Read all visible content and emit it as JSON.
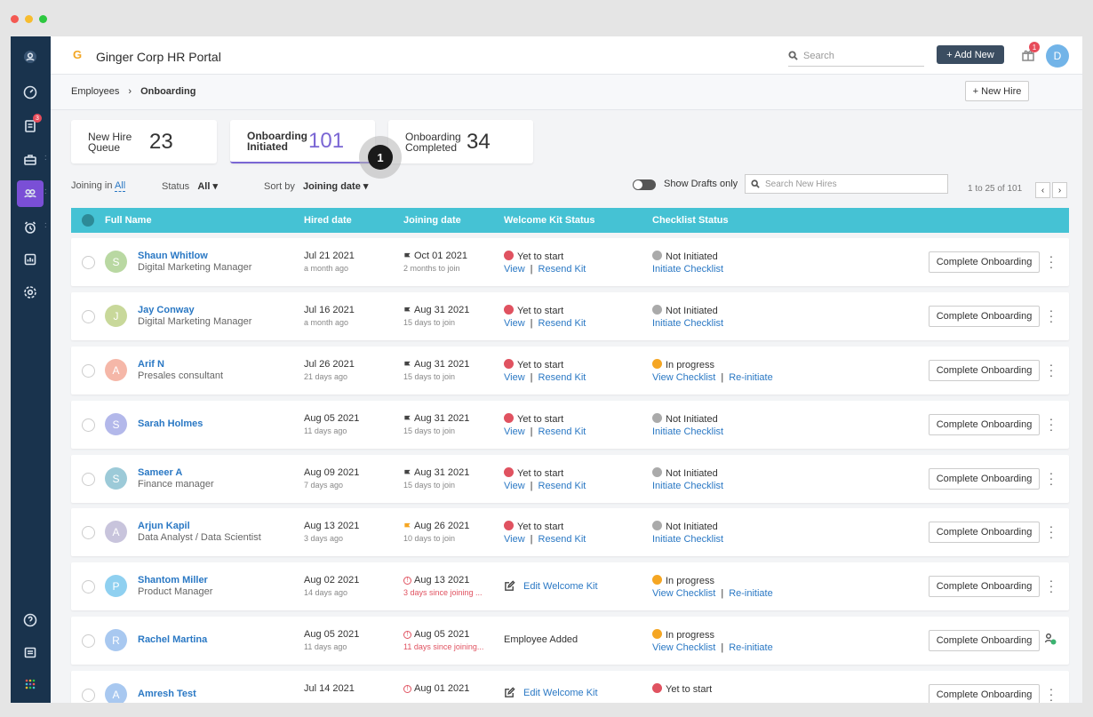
{
  "colors": {
    "accent": "#7a66d4",
    "teal": "#45c2d4",
    "sidebar": "#19334d",
    "red": "#e05260",
    "yellow": "#f5a623",
    "grey": "#aaa"
  },
  "header": {
    "logo": "G",
    "title": "Ginger Corp HR Portal",
    "search_placeholder": "Search",
    "add_new": "+ Add New",
    "gift_badge": "1",
    "user_initial": "D"
  },
  "sidebar": {
    "badge": "3",
    "icons": [
      "dashboard-icon",
      "tasks-icon",
      "briefcase-icon",
      "people-icon",
      "alarm-icon",
      "reports-icon",
      "settings-icon",
      "help-icon",
      "chat-icon",
      "apps-icon"
    ]
  },
  "breadcrumb": {
    "root": "Employees",
    "sep": "›",
    "current": "Onboarding"
  },
  "new_hire_btn": "+ New Hire",
  "cards": [
    {
      "label": "New Hire Queue",
      "count": "23"
    },
    {
      "label": "Onboarding Initiated",
      "count": "101"
    },
    {
      "label": "Onboarding Completed",
      "count": "34"
    }
  ],
  "step_marker": "1",
  "filters": {
    "joining_label": "Joining in",
    "joining_value": "All",
    "status_label": "Status",
    "status_value": "All",
    "sort_label": "Sort by",
    "sort_value": "Joining date",
    "drafts": "Show Drafts only",
    "search_placeholder": "Search New Hires",
    "pagination": "1 to 25 of 101"
  },
  "table": {
    "headers": [
      "Full Name",
      "Hired date",
      "Joining date",
      "Welcome Kit Status",
      "Checklist Status"
    ],
    "rows": [
      {
        "initial": "S",
        "avatar_color": "#b9d8a2",
        "name": "Shaun Whitlow",
        "role": "Digital Marketing Manager",
        "hired": "Jul 21 2021",
        "hired_ago": "a month ago",
        "joining": "Oct 01 2021",
        "joining_note": "2 months to join",
        "joining_icon": "flag-dark",
        "kit_status": "Yet to start",
        "kit_color": "#e05260",
        "kit_links": [
          "View",
          "Resend Kit"
        ],
        "check_status": "Not Initiated",
        "check_color": "#aaa",
        "check_links": [
          "Initiate Checklist"
        ],
        "action": "Complete Onboarding"
      },
      {
        "initial": "J",
        "avatar_color": "#c8d89a",
        "name": "Jay Conway",
        "role": "Digital Marketing Manager",
        "hired": "Jul 16 2021",
        "hired_ago": "a month ago",
        "joining": "Aug 31 2021",
        "joining_note": "15 days to join",
        "joining_icon": "flag-dark",
        "kit_status": "Yet to start",
        "kit_color": "#e05260",
        "kit_links": [
          "View",
          "Resend Kit"
        ],
        "check_status": "Not Initiated",
        "check_color": "#aaa",
        "check_links": [
          "Initiate Checklist"
        ],
        "action": "Complete Onboarding"
      },
      {
        "initial": "A",
        "avatar_color": "#f5b7a8",
        "name": "Arif N",
        "role": "Presales consultant",
        "hired": "Jul 26 2021",
        "hired_ago": "21 days ago",
        "joining": "Aug 31 2021",
        "joining_note": "15 days to join",
        "joining_icon": "flag-dark",
        "kit_status": "Yet to start",
        "kit_color": "#e05260",
        "kit_links": [
          "View",
          "Resend Kit"
        ],
        "check_status": "In progress",
        "check_color": "#f5a623",
        "check_links": [
          "View Checklist",
          "Re-initiate"
        ],
        "action": "Complete Onboarding"
      },
      {
        "initial": "S",
        "avatar_color": "#b3b8ea",
        "name": "Sarah Holmes",
        "role": "",
        "hired": "Aug 05 2021",
        "hired_ago": "11 days ago",
        "joining": "Aug 31 2021",
        "joining_note": "15 days to join",
        "joining_icon": "flag-dark",
        "kit_status": "Yet to start",
        "kit_color": "#e05260",
        "kit_links": [
          "View",
          "Resend Kit"
        ],
        "check_status": "Not Initiated",
        "check_color": "#aaa",
        "check_links": [
          "Initiate Checklist"
        ],
        "action": "Complete Onboarding"
      },
      {
        "initial": "S",
        "avatar_color": "#9ccad8",
        "name": "Sameer A",
        "role": "Finance manager",
        "hired": "Aug 09 2021",
        "hired_ago": "7 days ago",
        "joining": "Aug 31 2021",
        "joining_note": "15 days to join",
        "joining_icon": "flag-dark",
        "kit_status": "Yet to start",
        "kit_color": "#e05260",
        "kit_links": [
          "View",
          "Resend Kit"
        ],
        "check_status": "Not Initiated",
        "check_color": "#aaa",
        "check_links": [
          "Initiate Checklist"
        ],
        "action": "Complete Onboarding"
      },
      {
        "initial": "A",
        "avatar_color": "#c8c4dc",
        "name": "Arjun Kapil",
        "role": "Data Analyst / Data Scientist",
        "hired": "Aug 13 2021",
        "hired_ago": "3 days ago",
        "joining": "Aug 26 2021",
        "joining_note": "10 days to join",
        "joining_icon": "flag-yellow",
        "kit_status": "Yet to start",
        "kit_color": "#e05260",
        "kit_links": [
          "View",
          "Resend Kit"
        ],
        "check_status": "Not Initiated",
        "check_color": "#aaa",
        "check_links": [
          "Initiate Checklist"
        ],
        "action": "Complete Onboarding"
      },
      {
        "initial": "P",
        "avatar_color": "#8fd0f0",
        "name": "Shantom Miller",
        "role": "Product Manager",
        "hired": "Aug 02 2021",
        "hired_ago": "14 days ago",
        "joining": "Aug 13 2021",
        "joining_note": "3 days since joining ...",
        "joining_icon": "warn",
        "kit_edit": "Edit Welcome Kit",
        "check_status": "In progress",
        "check_color": "#f5a623",
        "check_links": [
          "View Checklist",
          "Re-initiate"
        ],
        "action": "Complete Onboarding"
      },
      {
        "initial": "R",
        "avatar_color": "#a8c8f0",
        "name": "Rachel Martina",
        "role": "",
        "hired": "Aug 05 2021",
        "hired_ago": "11 days ago",
        "joining": "Aug 05 2021",
        "joining_note": "11 days since joining...",
        "joining_icon": "warn",
        "kit_plain": "Employee Added",
        "check_status": "In progress",
        "check_color": "#f5a623",
        "check_links": [
          "View Checklist",
          "Re-initiate"
        ],
        "action": "Complete Onboarding",
        "person_icon": true
      },
      {
        "initial": "A",
        "avatar_color": "#a8c8f0",
        "name": "Amresh Test",
        "role": "",
        "hired": "Jul 14 2021",
        "hired_ago": "",
        "joining": "Aug 01 2021",
        "joining_note": "",
        "joining_icon": "warn",
        "kit_edit": "Edit Welcome Kit",
        "check_status": "Yet to start",
        "check_color": "#e05260",
        "check_links": [],
        "action": "Complete Onboarding"
      }
    ]
  }
}
